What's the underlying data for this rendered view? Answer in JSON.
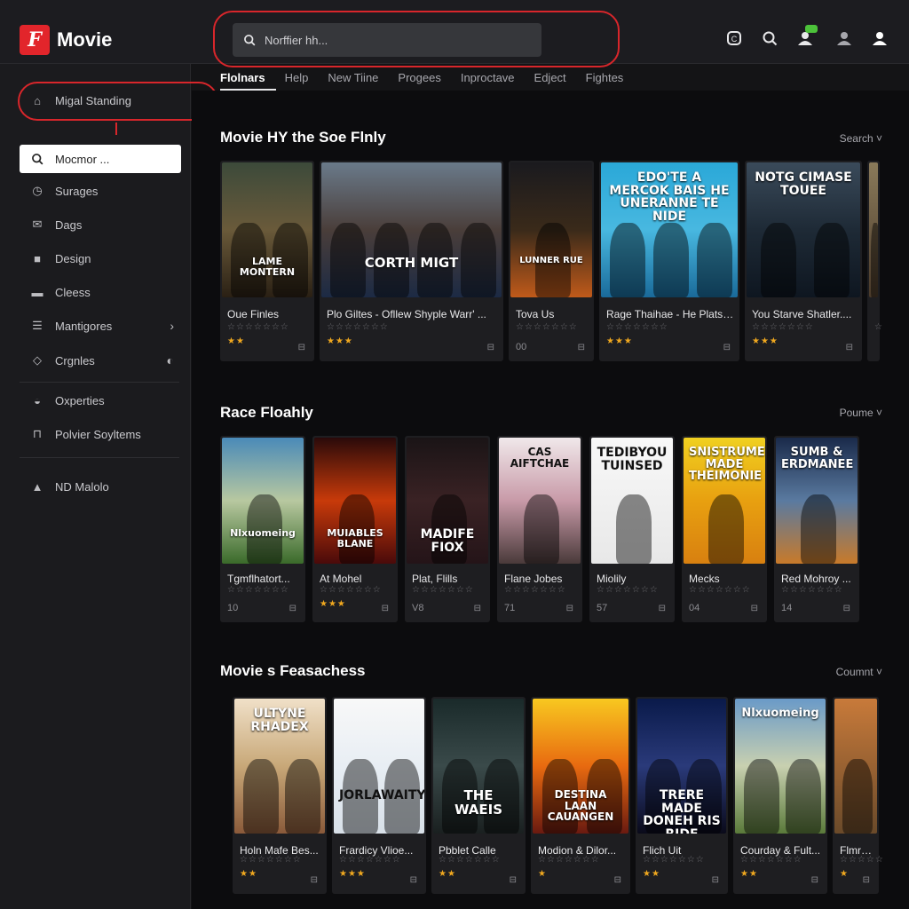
{
  "app": {
    "name": "Movie",
    "logo_glyph": "F",
    "brand_color": "#e2252b"
  },
  "search": {
    "placeholder": "Norffier hh..."
  },
  "top_icons": [
    "refresh-icon",
    "search-icon",
    "friends-icon",
    "user-icon",
    "account-icon"
  ],
  "tabs": [
    "Flolnars",
    "Help",
    "New Tiine",
    "Progees",
    "Inproctave",
    "Edject",
    "Fightes"
  ],
  "sidebar": {
    "top_item": "Migal Standing",
    "items": [
      {
        "label": "Mocmor ...",
        "icon": "search-icon"
      },
      {
        "label": "Surages",
        "icon": "clock-icon"
      },
      {
        "label": "Dags",
        "icon": "mail-icon"
      },
      {
        "label": "Design",
        "icon": "bag-icon"
      },
      {
        "label": "Cleess",
        "icon": "folder-icon"
      },
      {
        "label": "Mantigores",
        "icon": "list-icon"
      },
      {
        "label": "Crgnles",
        "icon": "tag-icon"
      },
      {
        "label": "Oxperties",
        "icon": "gauge-icon"
      },
      {
        "label": "Polvier Soyltems",
        "icon": "bookmark-icon"
      },
      {
        "label": "ND Malolo",
        "icon": "home-icon"
      }
    ]
  },
  "sections": [
    {
      "title": "Movie HY  the Soe Flnly",
      "sort": "Search",
      "cards": [
        {
          "title": "Oue Finles",
          "poster": "LAME MONTERN",
          "rating": 2,
          "meta": ""
        },
        {
          "title": "Plo Giltes - Ofllew Shyple Warr' ...",
          "poster": "CORTH MIGT",
          "rating": 3,
          "meta": ""
        },
        {
          "title": "Tova Us",
          "poster": "LUNNER RUE",
          "rating": 0,
          "meta": "00"
        },
        {
          "title": "Rage Thaihae - He Plats ...",
          "poster": "EDO'TE A MERCOK BAIS HE UNERANNE TE NIDE",
          "rating": 3,
          "meta": ""
        },
        {
          "title": "You Starve Shatler....",
          "poster": "NOTG CIMASE TOUEE",
          "rating": 3,
          "meta": ""
        },
        {
          "title": "F",
          "poster": "",
          "rating": 0,
          "meta": ""
        }
      ]
    },
    {
      "title": "Race Floahly",
      "sort": "Poume",
      "cards": [
        {
          "title": "Tgmflhatort...",
          "poster": "Nlxuomeing",
          "rating": 0,
          "meta": "10"
        },
        {
          "title": "At Mohel",
          "poster": "MUIABLES BLANE",
          "rating": 3,
          "meta": ""
        },
        {
          "title": "Plat, Flills",
          "poster": "MADIFE FIOX",
          "rating": 0,
          "meta": "V8"
        },
        {
          "title": "Flane Jobes",
          "poster": "CAS AIFTCHAE",
          "rating": 0,
          "meta": "71"
        },
        {
          "title": "Miolily",
          "poster": "TEDIBYOU TUINSED",
          "rating": 0,
          "meta": "57"
        },
        {
          "title": "Mecks",
          "poster": "SNISTRUME MADE THEIMONIE",
          "rating": 0,
          "meta": "04"
        },
        {
          "title": "Red Mohroy ...",
          "poster": "SUMB & ERDMANEE",
          "rating": 0,
          "meta": "14"
        }
      ]
    },
    {
      "title": "Movie s Feasachess",
      "sort": "Coumnt",
      "cards": [
        {
          "title": "Holn Mafe Bes...",
          "poster": "ULTYNE RHADEX",
          "rating": 2,
          "meta": ""
        },
        {
          "title": "Frardicy Vlioe...",
          "poster": "JORLAWAITY",
          "rating": 3,
          "meta": ""
        },
        {
          "title": "Pbblet Calle",
          "poster": "THE WAEIS",
          "rating": 2,
          "meta": ""
        },
        {
          "title": "Modion & Dilor...",
          "poster": "DESTINA LAAN CAUANGEN",
          "rating": 1,
          "meta": ""
        },
        {
          "title": "Flich Uit",
          "poster": "TRERE MADE DONEH RIS RIDE",
          "rating": 2,
          "meta": ""
        },
        {
          "title": "Courday & Fult...",
          "poster": "Nlxuomeing",
          "rating": 2,
          "meta": ""
        },
        {
          "title": "Flmre S",
          "poster": "",
          "rating": 1,
          "meta": ""
        }
      ]
    }
  ]
}
